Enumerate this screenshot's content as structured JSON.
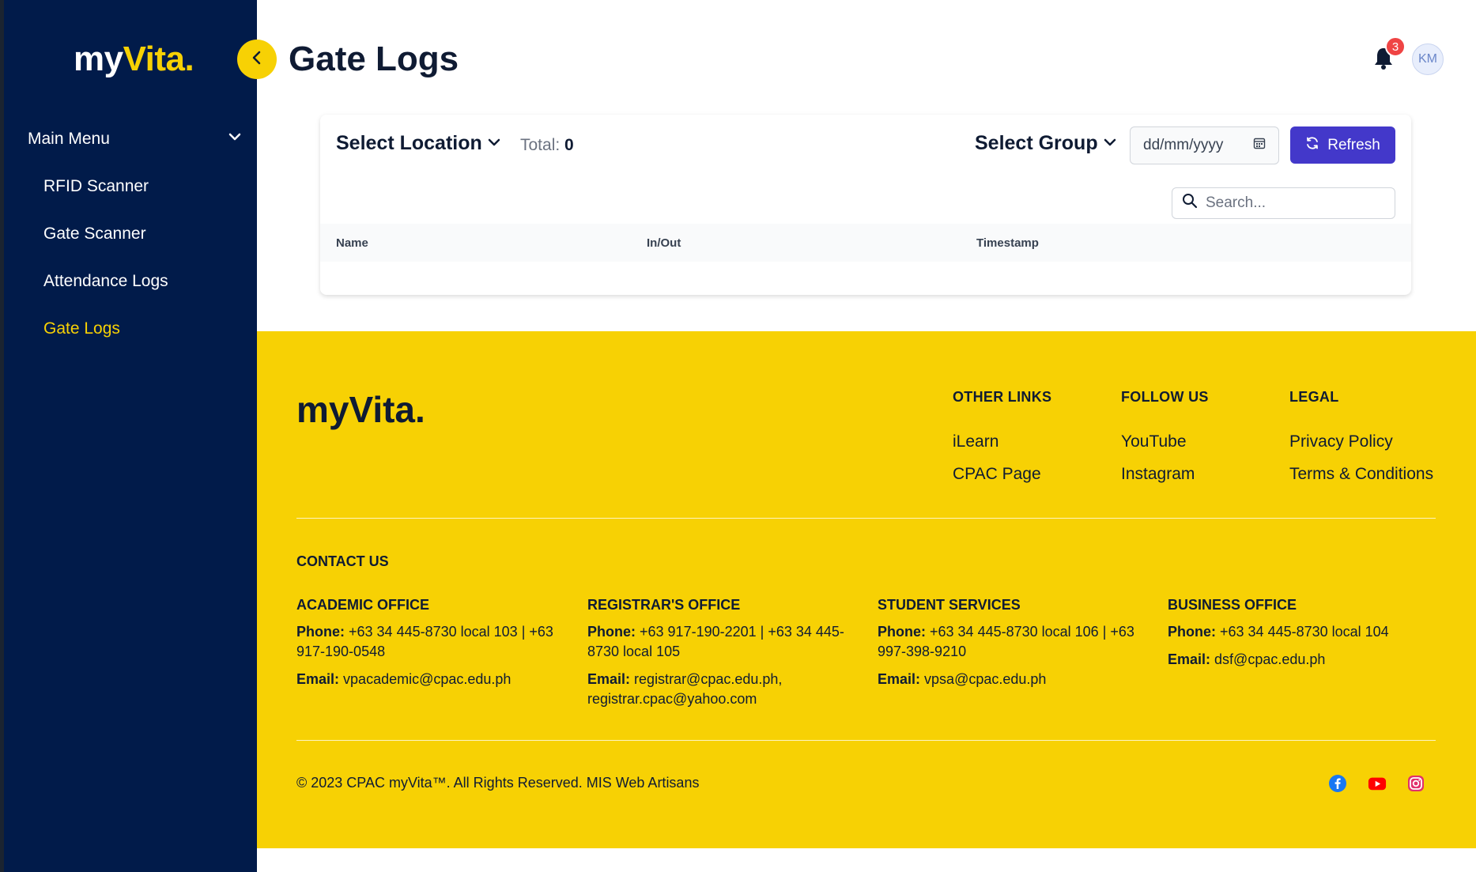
{
  "sidebar": {
    "logo_main": "my",
    "logo_accent": "Vita.",
    "menu_header": "Main Menu",
    "items": [
      {
        "label": "RFID Scanner"
      },
      {
        "label": "Gate Scanner"
      },
      {
        "label": "Attendance Logs"
      },
      {
        "label": "Gate Logs"
      }
    ]
  },
  "header": {
    "title": "Gate Logs",
    "notification_count": "3",
    "avatar_initials": "KM"
  },
  "card": {
    "select_location": "Select Location",
    "total_label": "Total:",
    "total_value": "0",
    "select_group": "Select Group",
    "date_placeholder": "dd/mm/yyyy",
    "refresh_label": "Refresh",
    "search_placeholder": "Search...",
    "columns": [
      "Name",
      "In/Out",
      "Timestamp"
    ]
  },
  "footer": {
    "logo": "myVita.",
    "other_links": {
      "title": "OTHER LINKS",
      "items": [
        "iLearn",
        "CPAC Page"
      ]
    },
    "follow_us": {
      "title": "FOLLOW US",
      "items": [
        "YouTube",
        "Instagram"
      ]
    },
    "legal": {
      "title": "LEGAL",
      "items": [
        "Privacy Policy",
        "Terms & Conditions"
      ]
    },
    "contact_title": "CONTACT US",
    "offices": [
      {
        "name": "ACADEMIC OFFICE",
        "phone_label": "Phone:",
        "phone": "+63 34 445-8730 local 103 | +63 917-190-0548",
        "email_label": "Email:",
        "email": "vpacademic@cpac.edu.ph"
      },
      {
        "name": "REGISTRAR'S OFFICE",
        "phone_label": "Phone:",
        "phone": "+63 917-190-2201 | +63 34 445-8730 local 105",
        "email_label": "Email:",
        "email": "registrar@cpac.edu.ph, registrar.cpac@yahoo.com"
      },
      {
        "name": "STUDENT SERVICES",
        "phone_label": "Phone:",
        "phone": "+63 34 445-8730 local 106 | +63 997-398-9210",
        "email_label": "Email:",
        "email": "vpsa@cpac.edu.ph"
      },
      {
        "name": "BUSINESS OFFICE",
        "phone_label": "Phone:",
        "phone": "+63 34 445-8730 local 104",
        "email_label": "Email:",
        "email": "dsf@cpac.edu.ph"
      }
    ],
    "copyright": "© 2023 CPAC myVita™. All Rights Reserved. MIS Web Artisans",
    "social_icons": [
      "facebook-icon",
      "youtube-icon",
      "instagram-icon"
    ]
  },
  "colors": {
    "sidebar_bg": "#011b4a",
    "accent_yellow": "#f7d104",
    "primary_button": "#4338ca",
    "badge": "#ef4444"
  }
}
